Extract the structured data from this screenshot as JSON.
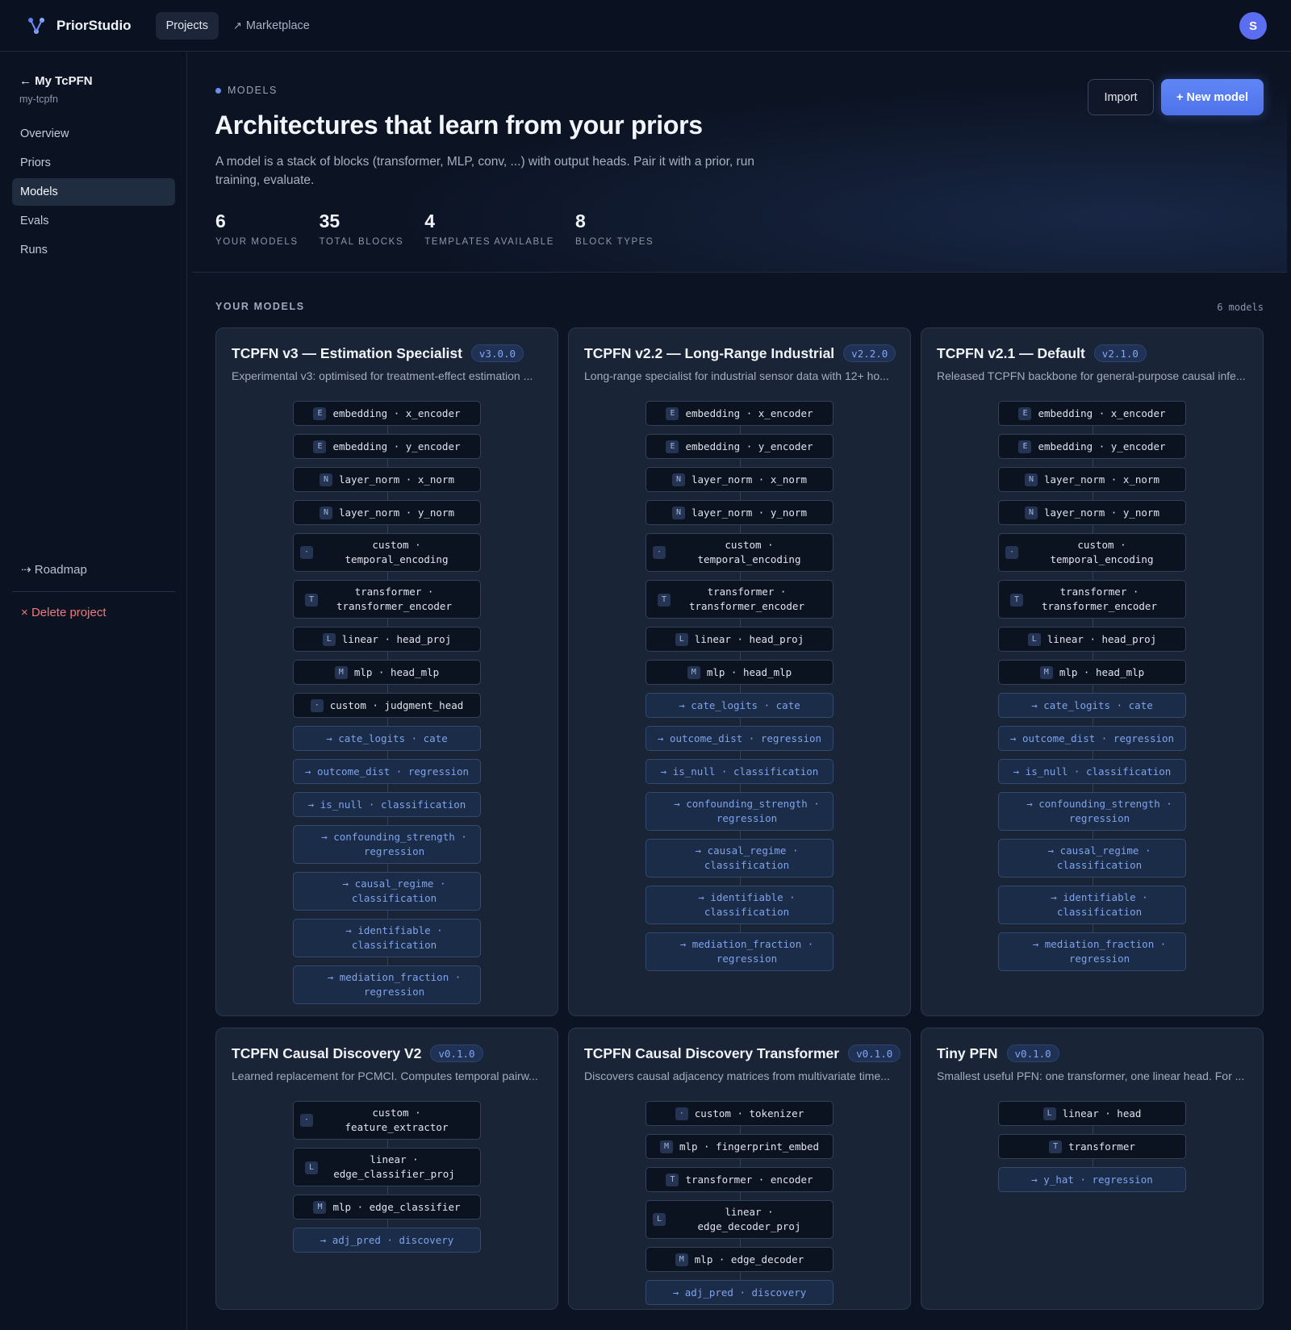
{
  "app": {
    "name": "PriorStudio",
    "avatar": "S"
  },
  "nav": {
    "projects": "Projects",
    "marketplace": "Marketplace"
  },
  "sidebar": {
    "back": "My TcPFN",
    "slug": "my-tcpfn",
    "items": [
      {
        "label": "Overview"
      },
      {
        "label": "Priors"
      },
      {
        "label": "Models"
      },
      {
        "label": "Evals"
      },
      {
        "label": "Runs"
      }
    ],
    "active": "Models",
    "roadmap": "Roadmap",
    "delete": "Delete project"
  },
  "hero": {
    "tag": "MODELS",
    "title": "Architectures that learn from your priors",
    "desc": "A model is a stack of blocks (transformer, MLP, conv, ...) with output heads. Pair it with a prior, run training, evaluate.",
    "import": "Import",
    "new_model": "+ New model",
    "stats": [
      {
        "value": "6",
        "label": "YOUR MODELS"
      },
      {
        "value": "35",
        "label": "TOTAL BLOCKS"
      },
      {
        "value": "4",
        "label": "TEMPLATES AVAILABLE"
      },
      {
        "value": "8",
        "label": "BLOCK TYPES"
      }
    ]
  },
  "models_section": {
    "heading": "YOUR MODELS",
    "count": "6 models"
  },
  "models": [
    {
      "title": "TCPFN v3 — Estimation Specialist",
      "version": "v3.0.0",
      "desc": "Experimental v3: optimised for treatment-effect estimation ...",
      "blocks": [
        {
          "kind": "body",
          "badge": "E",
          "text": "embedding · x_encoder"
        },
        {
          "kind": "body",
          "badge": "E",
          "text": "embedding · y_encoder"
        },
        {
          "kind": "body",
          "badge": "N",
          "text": "layer_norm · x_norm"
        },
        {
          "kind": "body",
          "badge": "N",
          "text": "layer_norm · y_norm"
        },
        {
          "kind": "body",
          "badge": "·",
          "text": "custom · temporal_encoding"
        },
        {
          "kind": "body",
          "badge": "T",
          "text": "transformer · transformer_encoder",
          "tall": true
        },
        {
          "kind": "body",
          "badge": "L",
          "text": "linear · head_proj"
        },
        {
          "kind": "body",
          "badge": "M",
          "text": "mlp · head_mlp"
        },
        {
          "kind": "body",
          "badge": "·",
          "text": "custom · judgment_head"
        },
        {
          "kind": "out",
          "text": "→ cate_logits · cate"
        },
        {
          "kind": "out",
          "text": "→ outcome_dist · regression"
        },
        {
          "kind": "out",
          "text": "→ is_null · classification"
        },
        {
          "kind": "out",
          "text": "→ confounding_strength · regression",
          "tall": true
        },
        {
          "kind": "out",
          "text": "→ causal_regime · classification",
          "tall": true
        },
        {
          "kind": "out",
          "text": "→ identifiable · classification",
          "tall": true
        },
        {
          "kind": "out",
          "text": "→ mediation_fraction · regression",
          "tall": true
        }
      ]
    },
    {
      "title": "TCPFN v2.2 — Long-Range Industrial",
      "version": "v2.2.0",
      "desc": "Long-range specialist for industrial sensor data with 12+ ho...",
      "blocks": [
        {
          "kind": "body",
          "badge": "E",
          "text": "embedding · x_encoder"
        },
        {
          "kind": "body",
          "badge": "E",
          "text": "embedding · y_encoder"
        },
        {
          "kind": "body",
          "badge": "N",
          "text": "layer_norm · x_norm"
        },
        {
          "kind": "body",
          "badge": "N",
          "text": "layer_norm · y_norm"
        },
        {
          "kind": "body",
          "badge": "·",
          "text": "custom · temporal_encoding"
        },
        {
          "kind": "body",
          "badge": "T",
          "text": "transformer · transformer_encoder",
          "tall": true
        },
        {
          "kind": "body",
          "badge": "L",
          "text": "linear · head_proj"
        },
        {
          "kind": "body",
          "badge": "M",
          "text": "mlp · head_mlp"
        },
        {
          "kind": "out",
          "text": "→ cate_logits · cate"
        },
        {
          "kind": "out",
          "text": "→ outcome_dist · regression"
        },
        {
          "kind": "out",
          "text": "→ is_null · classification"
        },
        {
          "kind": "out",
          "text": "→ confounding_strength · regression",
          "tall": true
        },
        {
          "kind": "out",
          "text": "→ causal_regime · classification",
          "tall": true
        },
        {
          "kind": "out",
          "text": "→ identifiable · classification",
          "tall": true
        },
        {
          "kind": "out",
          "text": "→ mediation_fraction · regression",
          "tall": true
        }
      ]
    },
    {
      "title": "TCPFN v2.1 — Default",
      "version": "v2.1.0",
      "desc": "Released TCPFN backbone for general-purpose causal infe...",
      "blocks": [
        {
          "kind": "body",
          "badge": "E",
          "text": "embedding · x_encoder"
        },
        {
          "kind": "body",
          "badge": "E",
          "text": "embedding · y_encoder"
        },
        {
          "kind": "body",
          "badge": "N",
          "text": "layer_norm · x_norm"
        },
        {
          "kind": "body",
          "badge": "N",
          "text": "layer_norm · y_norm"
        },
        {
          "kind": "body",
          "badge": "·",
          "text": "custom · temporal_encoding"
        },
        {
          "kind": "body",
          "badge": "T",
          "text": "transformer · transformer_encoder",
          "tall": true
        },
        {
          "kind": "body",
          "badge": "L",
          "text": "linear · head_proj"
        },
        {
          "kind": "body",
          "badge": "M",
          "text": "mlp · head_mlp"
        },
        {
          "kind": "out",
          "text": "→ cate_logits · cate"
        },
        {
          "kind": "out",
          "text": "→ outcome_dist · regression"
        },
        {
          "kind": "out",
          "text": "→ is_null · classification"
        },
        {
          "kind": "out",
          "text": "→ confounding_strength · regression",
          "tall": true
        },
        {
          "kind": "out",
          "text": "→ causal_regime · classification",
          "tall": true
        },
        {
          "kind": "out",
          "text": "→ identifiable · classification",
          "tall": true
        },
        {
          "kind": "out",
          "text": "→ mediation_fraction · regression",
          "tall": true
        }
      ]
    },
    {
      "title": "TCPFN Causal Discovery V2",
      "version": "v0.1.0",
      "desc": "Learned replacement for PCMCI. Computes temporal pairw...",
      "blocks": [
        {
          "kind": "body",
          "badge": "·",
          "text": "custom · feature_extractor"
        },
        {
          "kind": "body",
          "badge": "L",
          "text": "linear · edge_classifier_proj",
          "tall": true
        },
        {
          "kind": "body",
          "badge": "M",
          "text": "mlp · edge_classifier"
        },
        {
          "kind": "out",
          "text": "→ adj_pred · discovery"
        }
      ]
    },
    {
      "title": "TCPFN Causal Discovery Transformer",
      "version": "v0.1.0",
      "desc": "Discovers causal adjacency matrices from multivariate time...",
      "blocks": [
        {
          "kind": "body",
          "badge": "·",
          "text": "custom · tokenizer"
        },
        {
          "kind": "body",
          "badge": "M",
          "text": "mlp · fingerprint_embed"
        },
        {
          "kind": "body",
          "badge": "T",
          "text": "transformer · encoder"
        },
        {
          "kind": "body",
          "badge": "L",
          "text": "linear · edge_decoder_proj"
        },
        {
          "kind": "body",
          "badge": "M",
          "text": "mlp · edge_decoder"
        },
        {
          "kind": "out",
          "text": "→ adj_pred · discovery"
        }
      ]
    },
    {
      "title": "Tiny PFN",
      "version": "v0.1.0",
      "desc": "Smallest useful PFN: one transformer, one linear head. For ...",
      "blocks": [
        {
          "kind": "body",
          "badge": "L",
          "text": "linear · head"
        },
        {
          "kind": "body",
          "badge": "T",
          "text": "transformer"
        },
        {
          "kind": "out",
          "text": "→ y_hat · regression"
        }
      ]
    }
  ],
  "colors": {
    "accent": "#5b7ff3",
    "background": "#0c1424",
    "card": "#1a2437",
    "danger": "#f0797c"
  },
  "icons": {
    "logo": "fork-logo-icon",
    "marketplace": "external-arrow-icon",
    "back": "arrow-left-icon",
    "roadmap": "arrow-right-icon",
    "delete": "close-icon"
  }
}
